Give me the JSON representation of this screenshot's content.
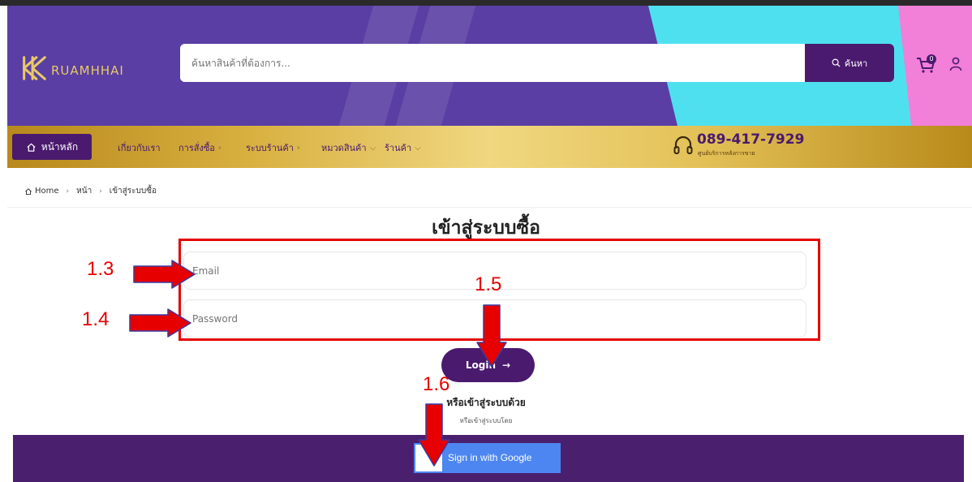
{
  "header": {
    "logo_text": "RUAMHHAI",
    "search_placeholder": "ค้นหาสินค้าที่ต้องการ...",
    "search_button": "ค้นหา",
    "cart_count": "0",
    "colors": {
      "primary": "#5a3ea3",
      "accent_cyan": "#4fe0f0",
      "accent_pink": "#f27fd8",
      "dark_purple": "#4a1a6e",
      "gold": "#e8c966"
    }
  },
  "nav": {
    "home": "หน้าหลัก",
    "items": [
      {
        "label": "เกี่ยวกับเรา",
        "chevron": ""
      },
      {
        "label": "การสั่งซื้อ",
        "chevron": "›"
      },
      {
        "label": "ระบบร้านค้า",
        "chevron": "›"
      },
      {
        "label": "หมวดสินค้า",
        "chevron": "⌵"
      },
      {
        "label": "ร้านค้า",
        "chevron": "⌵"
      }
    ],
    "hotline": "089-417-7929",
    "hotline_sub": "ศูนย์บริการหลังการขาย"
  },
  "breadcrumb": [
    "Home",
    "หน้า",
    "เข้าสู่ระบบซื้อ"
  ],
  "login": {
    "title": "เข้าสู่ระบบซื้อ",
    "email_placeholder": "Email",
    "password_placeholder": "Password",
    "button": "Login",
    "or_title": "หรือเข้าสู่ระบบด้วย",
    "or_sub": "หรือเข้าสู่ระบบโดย",
    "google": "Sign in with Google"
  },
  "annotations": [
    "1.3",
    "1.4",
    "1.5",
    "1.6"
  ]
}
